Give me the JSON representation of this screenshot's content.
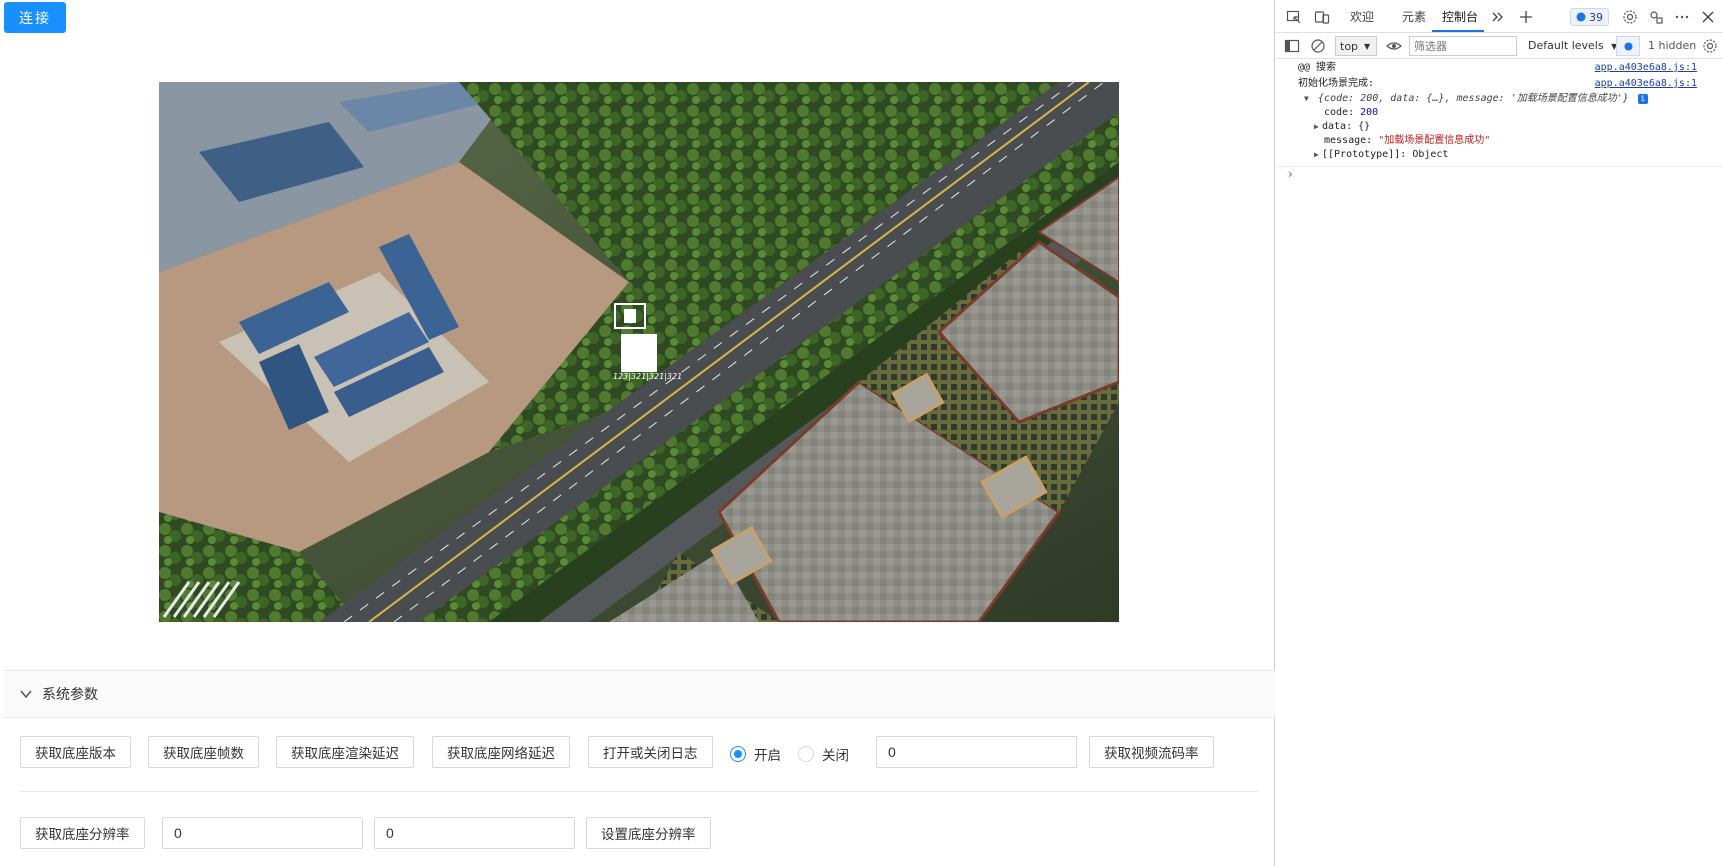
{
  "app": {
    "connect_label": "连接",
    "viewport": {
      "marker_label": "123|321|321|321"
    },
    "panel": {
      "title": "系统参数",
      "row1": {
        "get_version": "获取底座版本",
        "get_fps": "获取底座帧数",
        "get_render_latency": "获取底座渲染延迟",
        "get_network_latency": "获取底座网络延迟",
        "toggle_log": "打开或关闭日志",
        "radio_on": "开启",
        "radio_off": "关闭",
        "radio_selected": "开启",
        "bitrate_value": "0",
        "get_bitrate": "获取视频流码率"
      },
      "row2": {
        "get_resolution": "获取底座分辨率",
        "width_value": "0",
        "height_value": "0",
        "set_resolution": "设置底座分辨率"
      }
    }
  },
  "devtools": {
    "tabs": [
      {
        "label": "欢迎"
      },
      {
        "label": "元素"
      },
      {
        "label": "控制台",
        "active": true
      }
    ],
    "issues_count": "39",
    "toolbar": {
      "context": "top",
      "filter_placeholder": "筛选器",
      "levels": "Default levels",
      "hidden": "1 hidden"
    },
    "console": {
      "logs": [
        {
          "text": "@@ 搜索",
          "source": "app.a403e6a8.js:1"
        },
        {
          "text": "初始化场景完成:",
          "source": "app.a403e6a8.js:1"
        }
      ],
      "object_summary": "{code: 200, data: {…}, message: '加载场景配置信息成功'}",
      "props": [
        {
          "key": "code",
          "value": "200"
        },
        {
          "key": "data",
          "value": "{}"
        },
        {
          "key": "message",
          "value": "\"加载场景配置信息成功\""
        },
        {
          "key": "[[Prototype]]",
          "value": "Object"
        }
      ]
    }
  },
  "colors": {
    "primary": "#1890ff",
    "devtools_accent": "#1a73e8"
  }
}
